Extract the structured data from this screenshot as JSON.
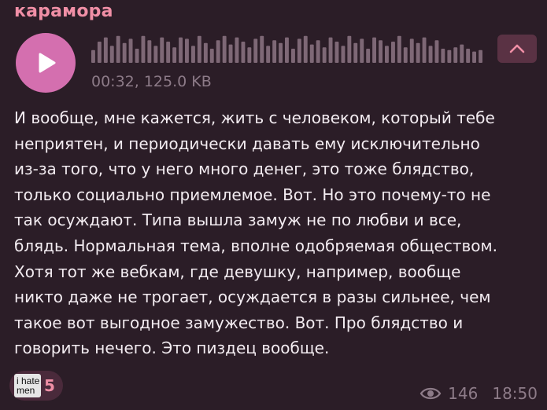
{
  "post": {
    "sender_name": "карамора",
    "voice": {
      "meta": "00:32, 125.0 KB",
      "play_icon": "play-icon",
      "collapse_icon": "chevron-up-icon",
      "waveform_levels": [
        0.45,
        0.75,
        0.9,
        0.6,
        0.95,
        0.7,
        0.85,
        0.5,
        0.95,
        0.8,
        0.6,
        0.9,
        0.75,
        0.55,
        0.9,
        0.85,
        0.6,
        0.95,
        0.7,
        0.5,
        0.8,
        0.95,
        0.65,
        0.9,
        0.75,
        0.55,
        0.85,
        0.95,
        0.6,
        0.8,
        0.7,
        0.9,
        0.5,
        0.85,
        0.95,
        0.65,
        0.8,
        0.55,
        0.9,
        0.75,
        0.6,
        0.95,
        0.7,
        0.85,
        0.5,
        0.9,
        0.8,
        0.6,
        0.75,
        0.95,
        0.55,
        0.85,
        0.7,
        0.9,
        0.6,
        0.8,
        0.5,
        0.45,
        0.55,
        0.65,
        0.5,
        0.4,
        0.45
      ]
    },
    "text_lines": [
      "И вообще, мне кажется, жить с человеком, который тебе",
      "неприятен, и периодически давать ему исключительно",
      "из-за того, что у него много денег, это тоже блядство,",
      "только социально приемлемое. Вот. Но это почему-то не",
      "так осуждают. Типа вышла замуж не по любви и все,",
      "блядь. Нормальная тема, вполне одобряемая обществом.",
      "Хотя тот же вебкам, где девушку, например, вообще",
      "никто даже не трогает, осуждается в разы сильнее, чем",
      "такое вот выгодное замужество. Вот. Про блядство и",
      "говорить нечего. Это пиздец вообще."
    ],
    "reaction": {
      "sticker_line1": "i hate",
      "sticker_line2": "men",
      "count": "5"
    },
    "views": "146",
    "time": "18:50",
    "views_icon": "eye-icon"
  },
  "colors": {
    "background": "#2b1d27",
    "accent": "#d46faf",
    "sender": "#f08fa6",
    "muted": "#8d7b88",
    "waveform": "#7e6876"
  }
}
